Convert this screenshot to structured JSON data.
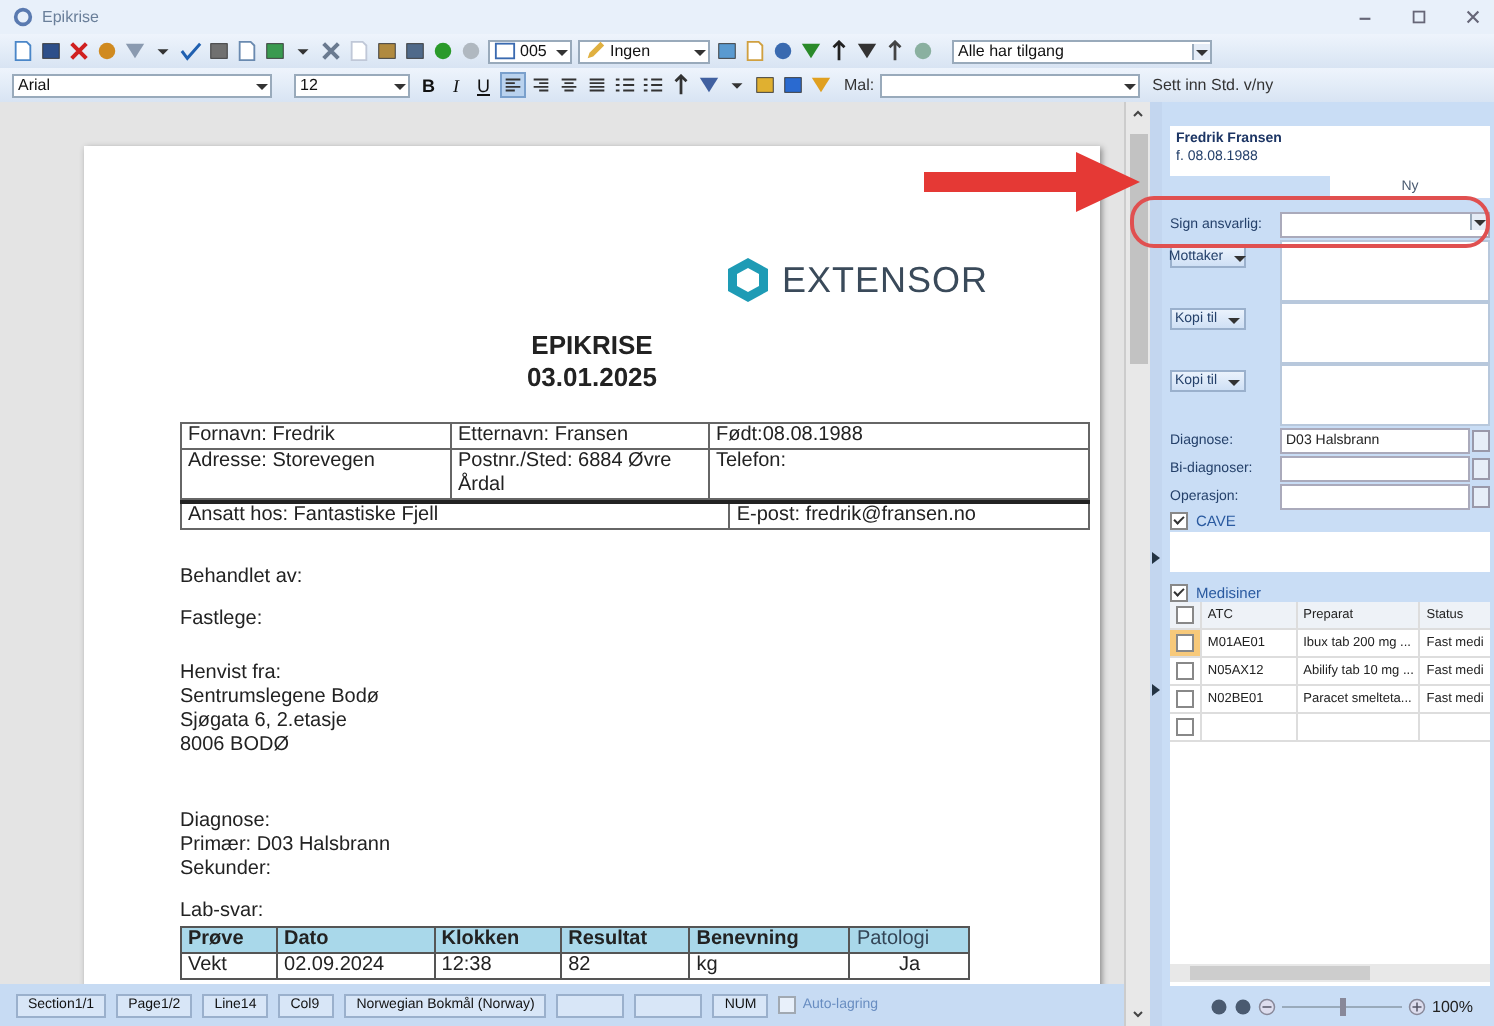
{
  "window": {
    "title": "Epikrise"
  },
  "toolbar": {
    "template_combo": "005",
    "status_combo": "Ingen",
    "access_combo": "Alle har tilgang"
  },
  "format_bar": {
    "font": "Arial",
    "size": "12",
    "style_buttons": [
      {
        "label": "B",
        "kind": "bold"
      },
      {
        "label": "I",
        "kind": "italic"
      },
      {
        "label": "U",
        "kind": "underline"
      }
    ],
    "align_buttons": [
      {
        "selected": true
      },
      {
        "selected": false
      },
      {
        "selected": false
      },
      {
        "selected": false
      }
    ],
    "template_label": "Mal:",
    "insert_label": "Sett inn Std. v/ny"
  },
  "document": {
    "logo": "EXTENSOR",
    "title": "EPIKRISE",
    "date": "03.01.2025",
    "info_rows": [
      [
        "Fornavn: Fredrik",
        "Etternavn: Fransen",
        "Født:08.08.1988"
      ],
      [
        "Adresse: Storevegen",
        "Postnr./Sted: 6884 Øvre Årdal",
        "Telefon:"
      ]
    ],
    "contact_row": [
      "Ansatt hos: Fantastiske Fjell",
      "E-post: fredrik@fransen.no"
    ],
    "blocks": [
      [
        "Behandlet av:"
      ],
      [
        "Fastlege:"
      ],
      [
        "Henvist fra:",
        "Sentrumslegene Bodø",
        "Sjøgata 6, 2.etasje",
        "8006 BODØ"
      ],
      [
        "Diagnose:",
        "Primær: D03 Halsbrann",
        "Sekunder:"
      ],
      [
        "Lab-svar:"
      ]
    ],
    "lab_table": {
      "columns": [
        {
          "label": "Prøve",
          "bold": true
        },
        {
          "label": "Dato",
          "bold": true
        },
        {
          "label": "Klokken",
          "bold": true
        },
        {
          "label": "Resultat",
          "bold": true
        },
        {
          "label": "Benevning",
          "bold": true
        },
        {
          "label": "Patologi",
          "bold": false
        }
      ],
      "rows": [
        [
          "Vekt",
          "02.09.2024",
          "12:38",
          "82",
          "kg",
          "Ja"
        ]
      ]
    }
  },
  "status_bar": {
    "panels": [
      {
        "text": "Section1/1"
      },
      {
        "text": "Page1/2"
      },
      {
        "text": "Line14"
      },
      {
        "text": "Col9"
      },
      {
        "text": "Norwegian Bokmål (Norway)"
      },
      {
        "kind": "blank"
      },
      {
        "kind": "blank"
      },
      {
        "text": "NUM"
      }
    ],
    "autosave": {
      "label": "Auto-lagring",
      "checked": false,
      "disabled": true
    }
  },
  "side_panel": {
    "patient": {
      "name": "Fredrik Fransen",
      "born": "f. 08.08.1988"
    },
    "new_button": "Ny",
    "sign": {
      "label": "Sign ansvarlig:"
    },
    "recipients": [
      {
        "label": "Mottaker"
      },
      {
        "label": "Kopi til"
      },
      {
        "label": "Kopi til"
      }
    ],
    "fields": [
      {
        "label": "Diagnose:",
        "value": "D03 Halsbrann"
      },
      {
        "label": "Bi-diagnoser:"
      },
      {
        "label": "Operasjon:"
      }
    ],
    "cave": {
      "label": "CAVE",
      "checked": true
    },
    "medications": {
      "label": "Medisiner",
      "checked": true,
      "all_checked": false,
      "columns": [
        "ATC",
        "Preparat",
        "Status"
      ],
      "rows": [
        {
          "atc": "M01AE01",
          "preparat": "Ibux tab 200 mg ...",
          "status": "Fast medi",
          "checked": false,
          "selected": true
        },
        {
          "atc": "N05AX12",
          "preparat": "Abilify tab 10 mg ...",
          "status": "Fast medi",
          "checked": false,
          "selected": false
        },
        {
          "atc": "N02BE01",
          "preparat": "Paracet smelteta...",
          "status": "Fast medi",
          "checked": false,
          "selected": false
        },
        {
          "checked": false,
          "selected": false
        }
      ]
    },
    "zoom": {
      "level": 0.5,
      "reading": "100%"
    }
  }
}
